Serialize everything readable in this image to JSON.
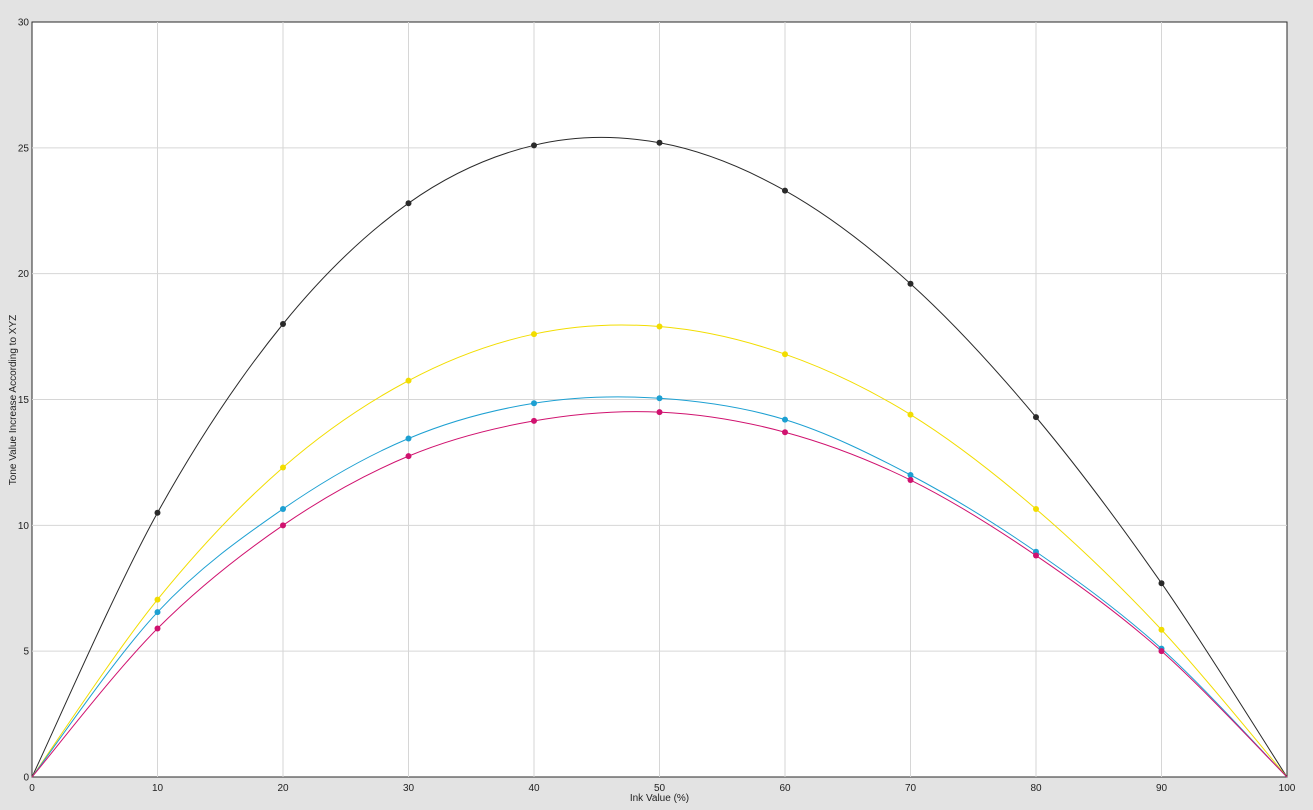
{
  "chart_data": {
    "type": "line",
    "xlabel": "Ink Value (%)",
    "ylabel": "Tone Value Increase According to XYZ",
    "xlim": [
      0,
      100
    ],
    "ylim": [
      0,
      30
    ],
    "x_ticks": [
      0,
      10,
      20,
      30,
      40,
      50,
      60,
      70,
      80,
      90,
      100
    ],
    "y_ticks": [
      0,
      5,
      10,
      15,
      20,
      25,
      30
    ],
    "grid": true,
    "legend": "none",
    "x": [
      0,
      10,
      20,
      30,
      40,
      50,
      60,
      70,
      80,
      90,
      100
    ],
    "series": [
      {
        "color": "#2a2a2a",
        "values": [
          0,
          10.5,
          18.0,
          22.8,
          25.1,
          25.2,
          23.3,
          19.6,
          14.3,
          7.7,
          0
        ]
      },
      {
        "color": "#f2dd00",
        "values": [
          0,
          7.05,
          12.3,
          15.75,
          17.6,
          17.9,
          16.8,
          14.4,
          10.65,
          5.85,
          0
        ]
      },
      {
        "color": "#1da0d2",
        "values": [
          0,
          6.55,
          10.65,
          13.45,
          14.85,
          15.05,
          14.2,
          12.0,
          8.95,
          5.1,
          0
        ]
      },
      {
        "color": "#d0126f",
        "values": [
          0,
          5.9,
          10.0,
          12.75,
          14.15,
          14.5,
          13.7,
          11.8,
          8.8,
          5.0,
          0
        ]
      }
    ]
  }
}
